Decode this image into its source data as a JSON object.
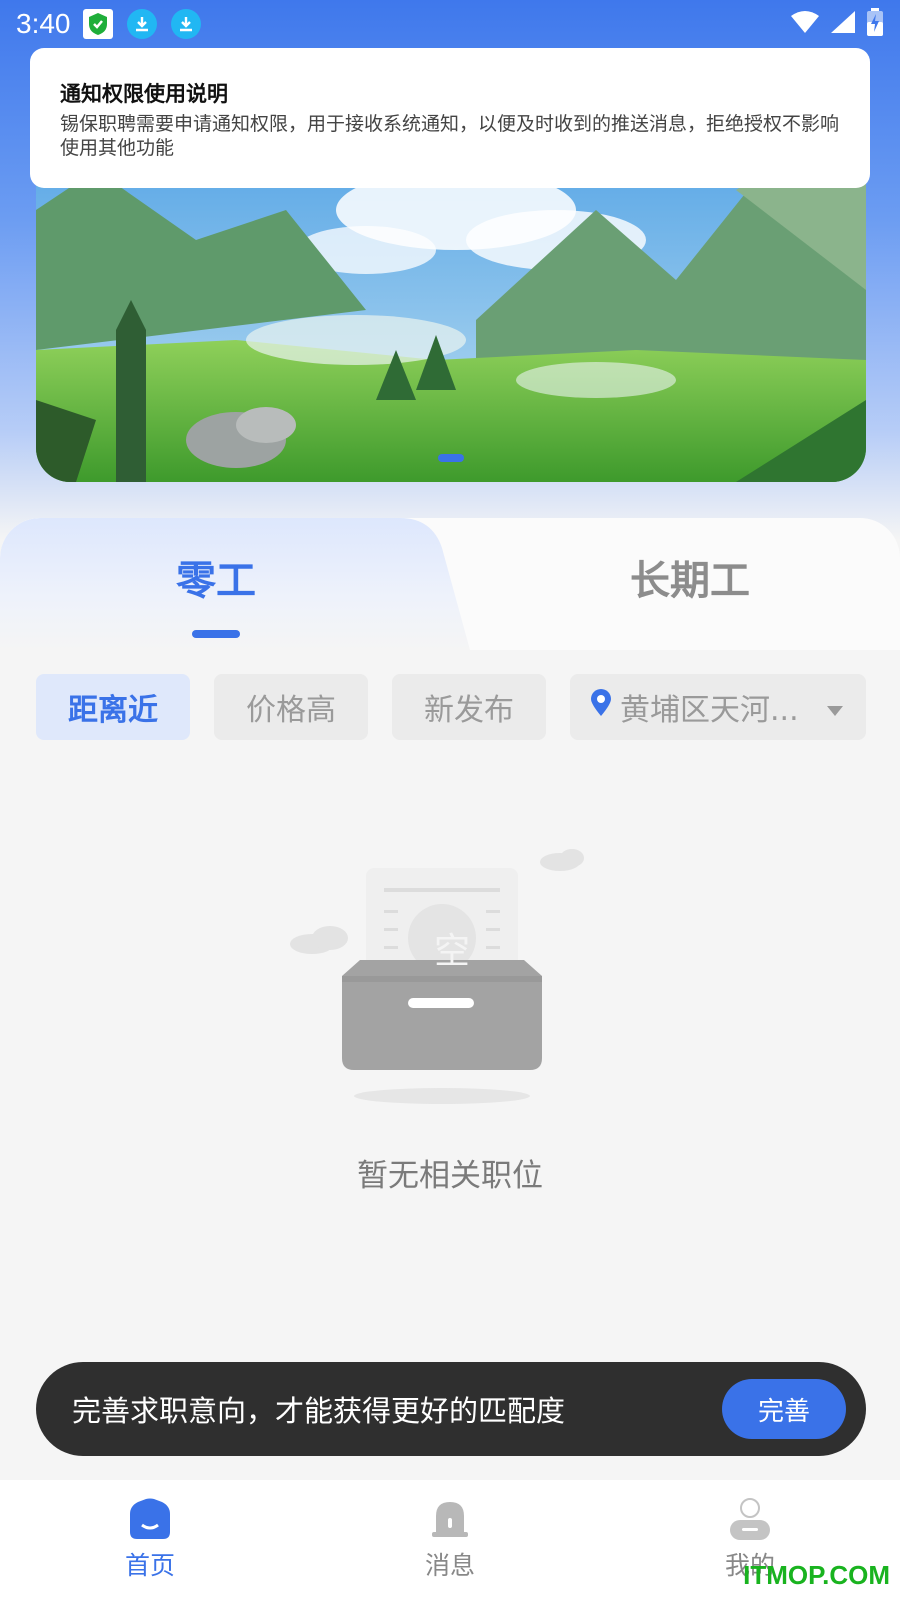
{
  "status_bar": {
    "time": "3:40",
    "icons": [
      "shield-icon",
      "download-icon",
      "download-icon",
      "wifi-icon",
      "signal-icon",
      "battery-charging-icon"
    ]
  },
  "notice": {
    "title": "通知权限使用说明",
    "body": "锡保职聘需要申请通知权限，用于接收系统通知，以便及时收到的推送消息，拒绝授权不影响使用其他功能"
  },
  "banner": {
    "slides_total": 1,
    "active_index": 0
  },
  "tabs": [
    {
      "label": "零工",
      "active": true
    },
    {
      "label": "长期工",
      "active": false
    }
  ],
  "filters": [
    {
      "label": "距离近",
      "active": true
    },
    {
      "label": "价格高",
      "active": false
    },
    {
      "label": "新发布",
      "active": false
    }
  ],
  "location_filter": {
    "label": "黄埔区天河...",
    "icon": "location-pin-icon"
  },
  "empty_state": {
    "badge": "空",
    "text": "暂无相关职位"
  },
  "prompt": {
    "text": "完善求职意向，才能获得更好的匹配度",
    "button": "完善"
  },
  "bottom_nav": [
    {
      "label": "首页",
      "icon": "home-icon",
      "active": true
    },
    {
      "label": "消息",
      "icon": "bell-icon",
      "active": false
    },
    {
      "label": "我的",
      "icon": "profile-icon",
      "active": false
    }
  ],
  "watermark": "ITMOP.COM",
  "colors": {
    "accent": "#3a72e8",
    "prompt_bg": "#2f2f2f",
    "watermark": "#19b31f"
  }
}
